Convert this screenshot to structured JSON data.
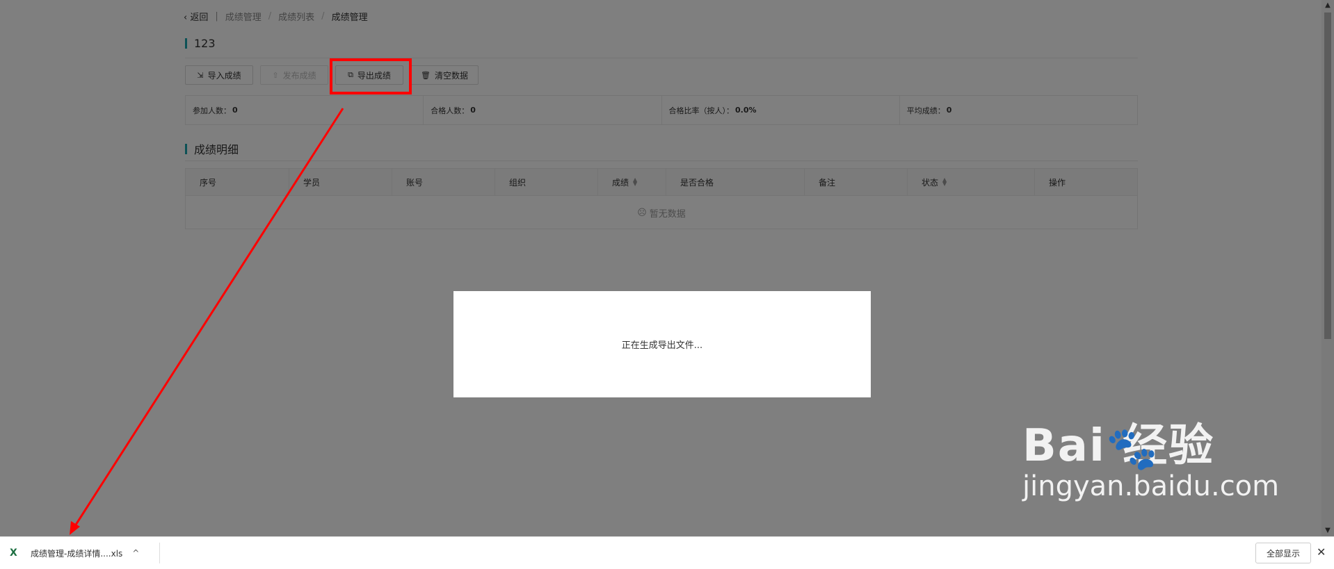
{
  "breadcrumb": {
    "back_icon": "‹",
    "back_label": "返回",
    "separator": "|",
    "items": [
      "成绩管理",
      "成绩列表",
      "成绩管理"
    ],
    "slash": "/"
  },
  "exam": {
    "title": "123"
  },
  "toolbar": {
    "import_label": "导入成绩",
    "publish_label": "发布成绩",
    "export_label": "导出成绩",
    "clear_label": "清空数据",
    "icons": {
      "import": "⇲",
      "publish": "⇧",
      "export": "⧉",
      "clear": "🗑"
    }
  },
  "stats": {
    "participants": {
      "label": "参加人数：",
      "value": "0"
    },
    "passed": {
      "label": "合格人数：",
      "value": "0"
    },
    "pass_rate": {
      "label": "合格比率（按人）：",
      "value": "0.0%"
    },
    "average": {
      "label": "平均成绩：",
      "value": "0"
    }
  },
  "details": {
    "title": "成绩明细",
    "columns": [
      "序号",
      "学员",
      "账号",
      "组织",
      "成绩",
      "是否合格",
      "备注",
      "状态",
      "操作"
    ],
    "empty_text": "暂无数据",
    "empty_icon": "☹"
  },
  "modal": {
    "message": "正在生成导出文件..."
  },
  "download_bar": {
    "file_name": "成绩管理-成绩详情....xls",
    "file_icon": "X",
    "chevron": "^",
    "show_all_label": "全部显示",
    "close_icon": "✕"
  },
  "watermark": {
    "logo": "Bai  经验",
    "paw": "🐾",
    "url": "jingyan.baidu.com"
  },
  "colors": {
    "accent": "#1ba4ad",
    "highlight": "#ff0000",
    "overlay": "rgba(0,0,0,0.5)"
  }
}
